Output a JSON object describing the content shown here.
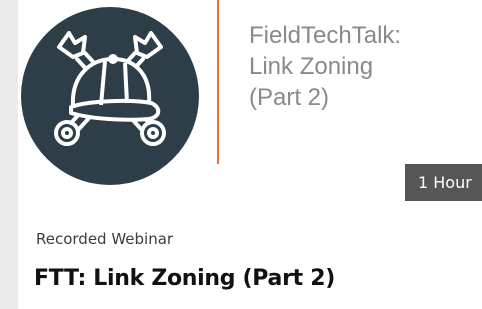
{
  "card": {
    "banner_title_lines": [
      "FieldTechTalk:",
      "Link Zoning",
      "(Part 2)"
    ],
    "duration": "1 Hour",
    "type_label": "Recorded Webinar",
    "title": "FTT: Link Zoning (Part 2)"
  },
  "icons": {
    "logo": "wrench-and-cap-logo-icon"
  },
  "colors": {
    "logo_circle": "#2d3e48",
    "accent_line": "#e8703a",
    "badge_bg": "#565656",
    "page_bg": "#ebebeb"
  }
}
